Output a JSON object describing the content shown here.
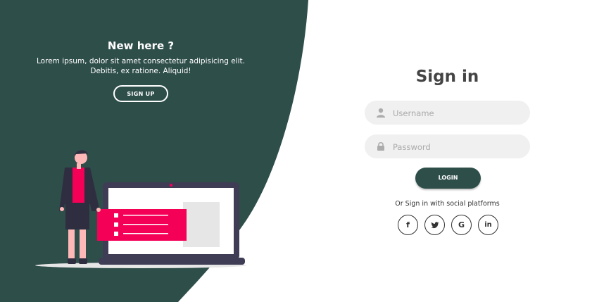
{
  "left_panel": {
    "title": "New here ?",
    "text": "Lorem ipsum, dolor sit amet consectetur adipisicing elit. Debitis, ex ratione. Aliquid!",
    "signup_label": "SIGN UP"
  },
  "signin": {
    "title": "Sign in",
    "username_placeholder": "Username",
    "password_placeholder": "Password",
    "login_label": "LOGIN",
    "social_text": "Or Sign in with social platforms"
  },
  "social": {
    "facebook": "f",
    "twitter": "twitter-icon",
    "google": "G",
    "linkedin": "in"
  },
  "colors": {
    "panel": "#2e4e4a",
    "accent": "#f50057",
    "field_bg": "#f0f0f0"
  }
}
